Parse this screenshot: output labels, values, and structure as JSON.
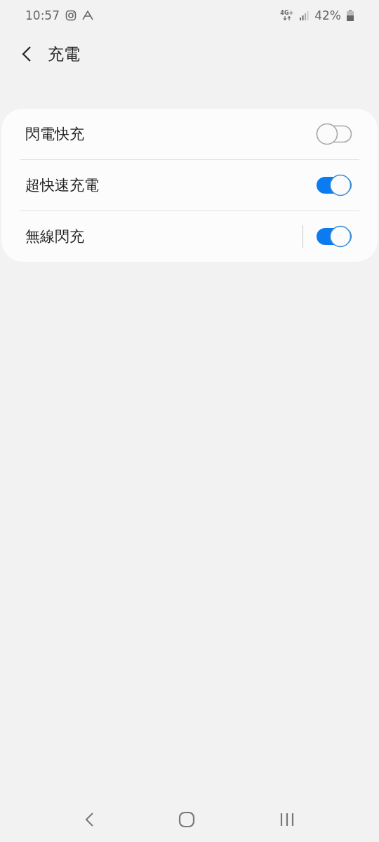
{
  "status_bar": {
    "time": "10:57",
    "network": "4G+",
    "battery": "42%"
  },
  "header": {
    "title": "充電"
  },
  "settings": [
    {
      "label": "閃電快充",
      "on": false,
      "divided": false
    },
    {
      "label": "超快速充電",
      "on": true,
      "divided": false
    },
    {
      "label": "無線閃充",
      "on": true,
      "divided": true
    }
  ]
}
